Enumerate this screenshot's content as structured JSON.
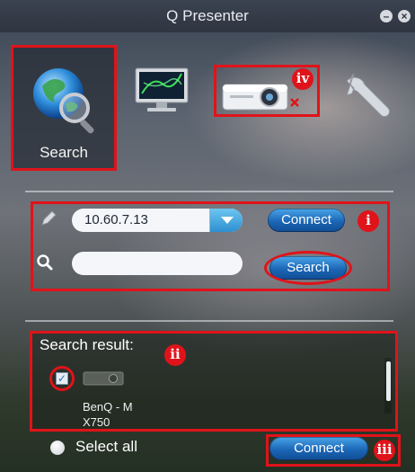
{
  "window": {
    "title": "Q Presenter",
    "minimize_label": "–",
    "close_label": "×"
  },
  "toolbar": {
    "tools": [
      {
        "name": "search",
        "label": "Search",
        "icon": "globe-magnifier-icon",
        "selected": true
      },
      {
        "name": "display",
        "label": "",
        "icon": "monitor-icon"
      },
      {
        "name": "projector",
        "label": "",
        "icon": "projector-icon"
      },
      {
        "name": "settings",
        "label": "",
        "icon": "wrench-icon"
      }
    ]
  },
  "connection": {
    "ip_value": "10.60.7.13",
    "connect_label": "Connect",
    "search_placeholder": "",
    "search_label": "Search"
  },
  "results": {
    "title": "Search result:",
    "devices": [
      {
        "name_line1": "BenQ - M",
        "name_line2": "X750",
        "checked": true
      }
    ]
  },
  "footer": {
    "select_all_label": "Select all",
    "connect_label": "Connect"
  },
  "annotations": {
    "i": "i",
    "ii": "ii",
    "iii": "iii",
    "iv": "iv"
  },
  "colors": {
    "highlight": "#e0131a",
    "accent_blue": "#2e8fd0"
  }
}
